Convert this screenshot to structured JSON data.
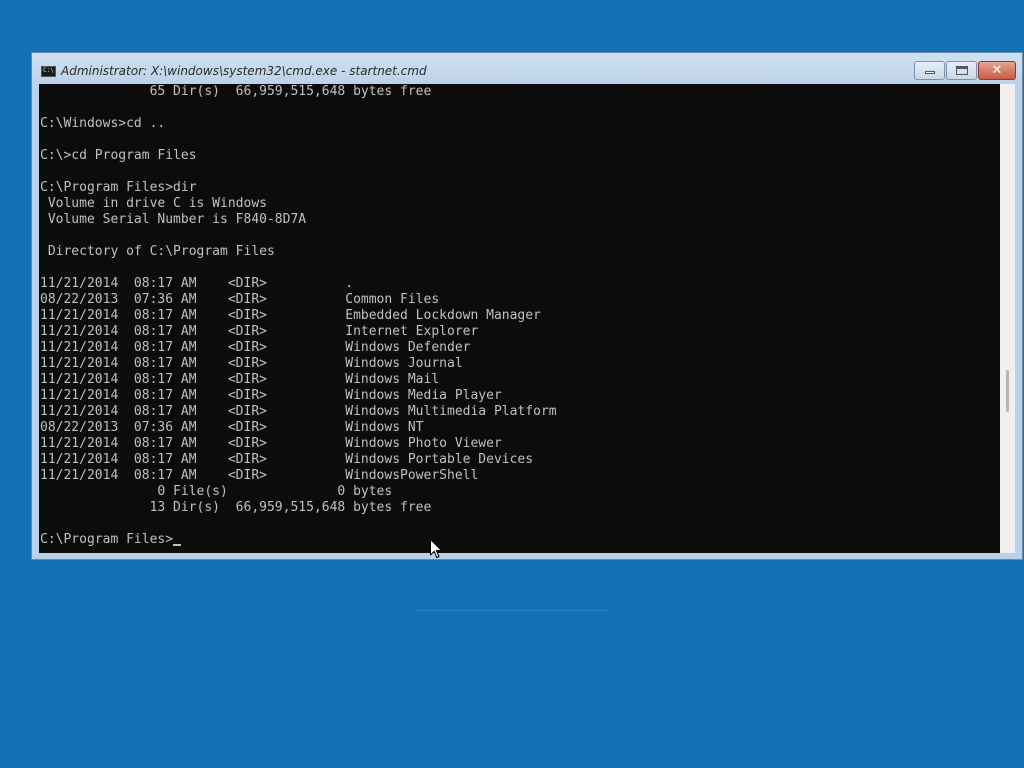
{
  "window": {
    "title": "Administrator: X:\\windows\\system32\\cmd.exe - startnet.cmd",
    "icon_text": "C:\\",
    "close_glyph": "✕"
  },
  "console": {
    "lines": [
      "              65 Dir(s)  66,959,515,648 bytes free",
      "",
      "C:\\Windows>cd ..",
      "",
      "C:\\>cd Program Files",
      "",
      "C:\\Program Files>dir",
      " Volume in drive C is Windows",
      " Volume Serial Number is F840-8D7A",
      "",
      " Directory of C:\\Program Files",
      "",
      "11/21/2014  08:17 AM    <DIR>          .",
      "08/22/2013  07:36 AM    <DIR>          Common Files",
      "11/21/2014  08:17 AM    <DIR>          Embedded Lockdown Manager",
      "11/21/2014  08:17 AM    <DIR>          Internet Explorer",
      "11/21/2014  08:17 AM    <DIR>          Windows Defender",
      "11/21/2014  08:17 AM    <DIR>          Windows Journal",
      "11/21/2014  08:17 AM    <DIR>          Windows Mail",
      "11/21/2014  08:17 AM    <DIR>          Windows Media Player",
      "11/21/2014  08:17 AM    <DIR>          Windows Multimedia Platform",
      "08/22/2013  07:36 AM    <DIR>          Windows NT",
      "11/21/2014  08:17 AM    <DIR>          Windows Photo Viewer",
      "11/21/2014  08:17 AM    <DIR>          Windows Portable Devices",
      "11/21/2014  08:17 AM    <DIR>          WindowsPowerShell",
      "               0 File(s)              0 bytes",
      "              13 Dir(s)  66,959,515,648 bytes free",
      ""
    ],
    "prompt": "C:\\Program Files>"
  },
  "icons": {
    "app": "console-app-icon",
    "minimize": "minimize-icon",
    "maximize": "maximize-icon",
    "close": "close-icon",
    "pointer": "mouse-pointer-icon"
  },
  "colors": {
    "desktop": "#1371b5",
    "console_background": "#0c0c0c",
    "console_text": "#c0c0c0",
    "close_button": "#c75b45"
  }
}
